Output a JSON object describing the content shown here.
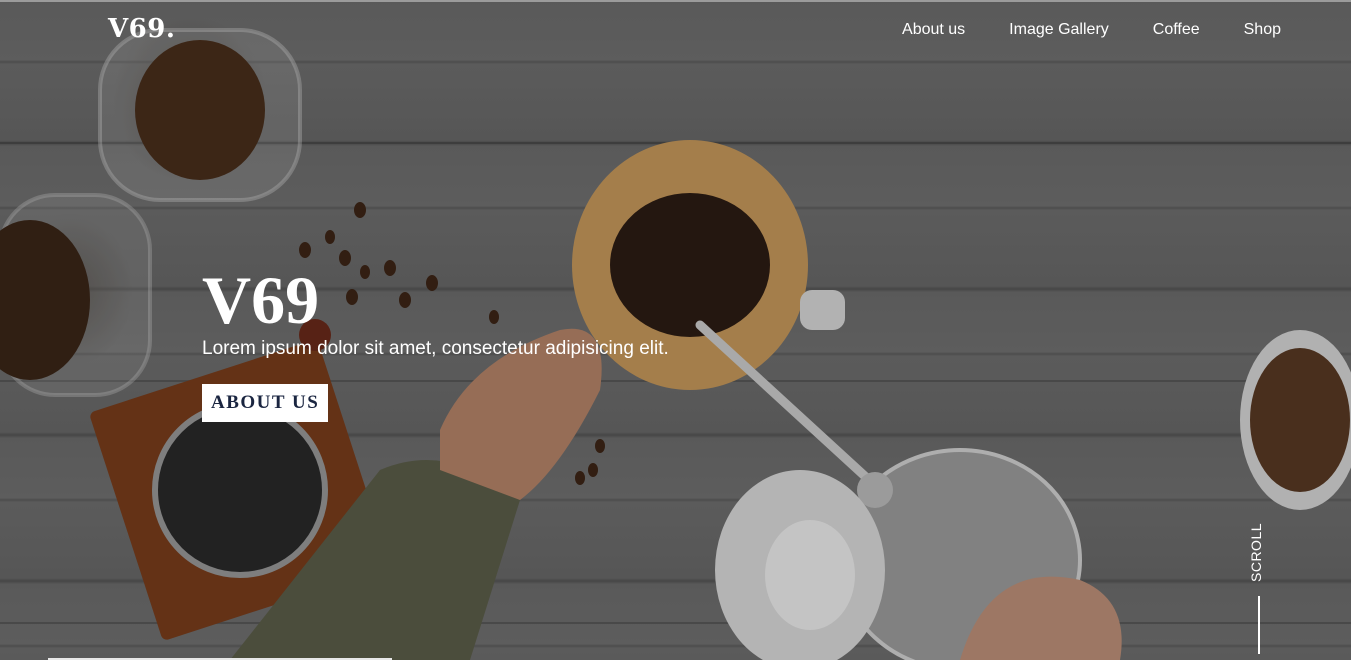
{
  "brand": {
    "logo": "V69."
  },
  "nav": {
    "items": [
      {
        "label": "About us"
      },
      {
        "label": "Image Gallery"
      },
      {
        "label": "Coffee"
      },
      {
        "label": "Shop"
      }
    ]
  },
  "hero": {
    "title": "V69",
    "subtitle": "Lorem ipsum dolor sit amet, consectetur adipisicing elit.",
    "button_label": "ABOUT US",
    "background_image": "coffee-pour-over-photo"
  },
  "scroll": {
    "label": "SCROLL"
  },
  "colors": {
    "text": "#ffffff",
    "button_bg": "#ffffff",
    "button_text": "#1a2540"
  }
}
